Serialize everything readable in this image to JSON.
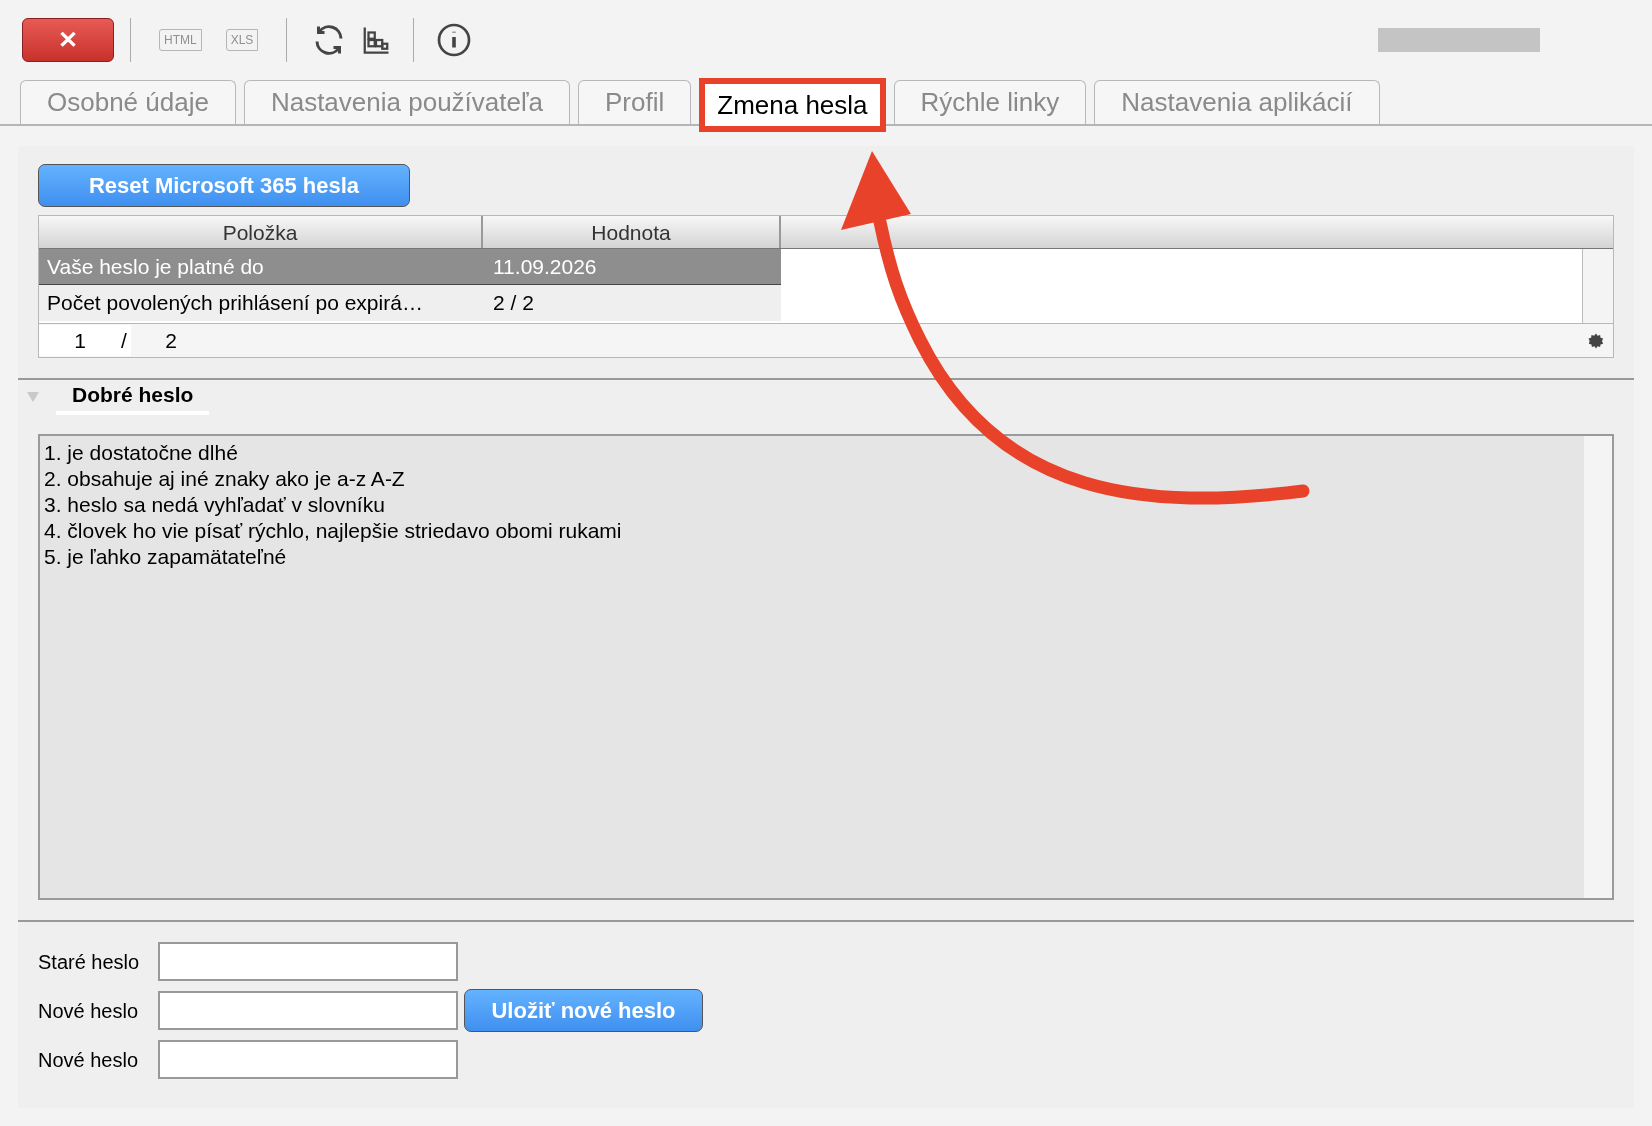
{
  "toolbar": {
    "buttons": [
      {
        "kind": "close",
        "label": "✕",
        "disabled": false
      },
      {
        "kind": "html",
        "label": "HTML",
        "disabled": true
      },
      {
        "kind": "xls",
        "label": "XLS",
        "disabled": true
      },
      {
        "kind": "refresh",
        "disabled": false
      },
      {
        "kind": "chart",
        "disabled": false
      },
      {
        "kind": "info",
        "disabled": false
      }
    ]
  },
  "tabs": [
    {
      "label": "Osobné údaje",
      "selected": false
    },
    {
      "label": "Nastavenia používateľa",
      "selected": false
    },
    {
      "label": "Profil",
      "selected": false
    },
    {
      "label": "Zmena hesla",
      "selected": true
    },
    {
      "label": "Rýchle linky",
      "selected": false
    },
    {
      "label": "Nastavenia aplikácií",
      "selected": false
    }
  ],
  "reset_button": "Reset Microsoft 365 hesla",
  "table": {
    "columns": [
      "Položka",
      "Hodnota"
    ],
    "rows": [
      {
        "cells": [
          "Vaše heslo je platné do",
          "11.09.2026"
        ],
        "selected": true
      },
      {
        "cells": [
          "Počet povolených prihlásení po expirá…",
          "2 / 2"
        ],
        "selected": false
      }
    ],
    "pager": {
      "current": "1",
      "separator": "/",
      "total": "2"
    }
  },
  "section": {
    "title": "Dobré heslo",
    "expanded": true,
    "lines": [
      "1. je dostatočne dlhé",
      "2. obsahuje aj iné znaky ako je a-z A-Z",
      "3. heslo sa nedá vyhľadať v slovníku",
      "4. človek ho vie písať rýchlo, najlepšie striedavo obomi rukami",
      "5. je ľahko zapamätateľné"
    ]
  },
  "form": {
    "fields": [
      {
        "label": "Staré heslo"
      },
      {
        "label": "Nové heslo"
      },
      {
        "label": "Nové heslo"
      }
    ],
    "save_button": "Uložiť nové heslo"
  }
}
